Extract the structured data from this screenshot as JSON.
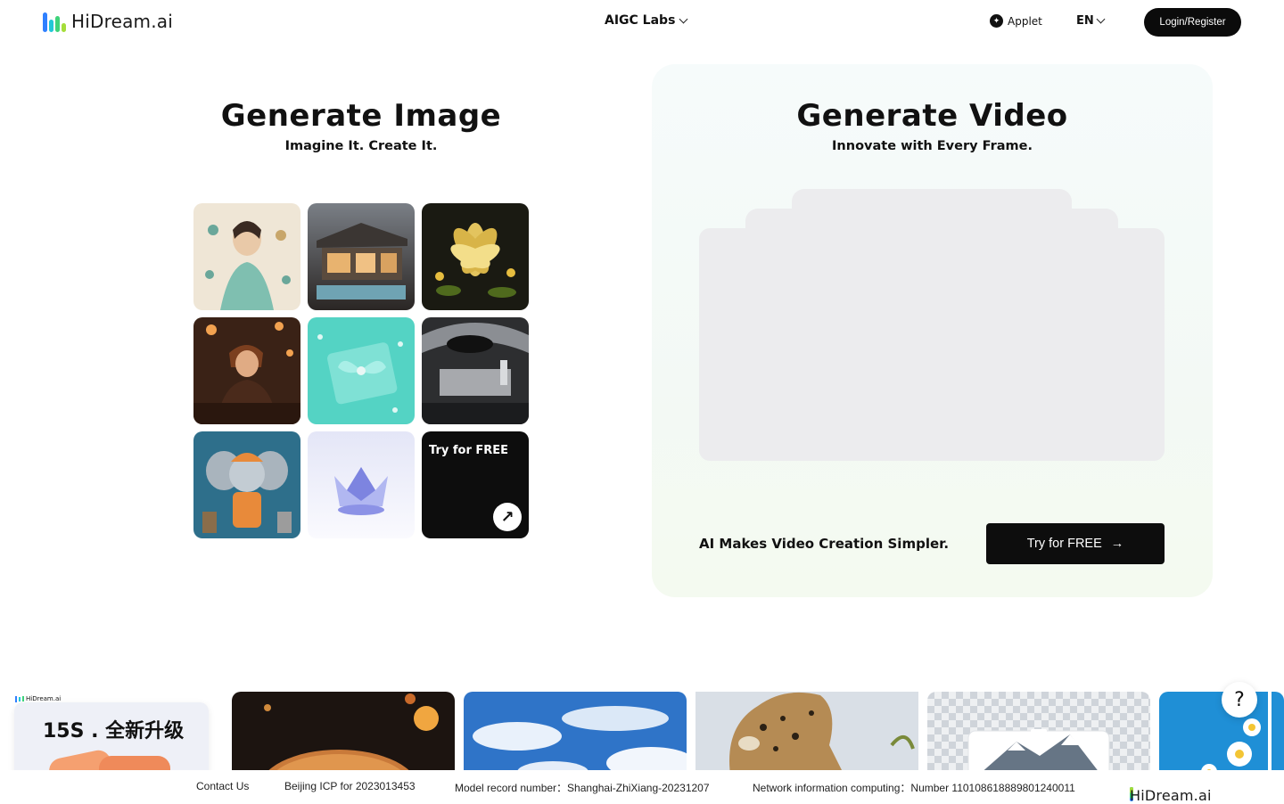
{
  "header": {
    "brand": "HiDream.ai",
    "nav_center": "AIGC Labs",
    "applet": "Applet",
    "language": "EN",
    "login": "Login/Register",
    "brand_colors": [
      "#2f80ff",
      "#22c7d6",
      "#3ed37a",
      "#a5dd3a"
    ]
  },
  "image_section": {
    "title": "Generate Image",
    "subtitle": "Imagine It. Create It.",
    "tiles": [
      {
        "name": "art-nouveau-woman-jewelry",
        "colors": [
          "#efe6d6",
          "#7fbfb0"
        ]
      },
      {
        "name": "modern-house-pool",
        "colors": [
          "#4b4a4a",
          "#c9a27a"
        ]
      },
      {
        "name": "golden-lotus",
        "colors": [
          "#1a1a12",
          "#e0c060"
        ]
      },
      {
        "name": "warrior-tavern",
        "colors": [
          "#3a2216",
          "#9b5a35"
        ]
      },
      {
        "name": "teal-gift-box",
        "colors": [
          "#54d3c4",
          "#8ee5db"
        ]
      },
      {
        "name": "spaceship-interior",
        "colors": [
          "#2d2e30",
          "#a7a9ad"
        ]
      },
      {
        "name": "cartoon-elephant-worker",
        "colors": [
          "#2e6f8b",
          "#e88a3a"
        ]
      },
      {
        "name": "crystal-crown",
        "colors": [
          "#eef0ff",
          "#7d84e0"
        ]
      }
    ],
    "try_label": "Try for FREE"
  },
  "video_section": {
    "title": "Generate Video",
    "subtitle": "Innovate with Every Frame.",
    "tagline": "AI Makes Video Creation Simpler.",
    "button": "Try for FREE"
  },
  "strip": {
    "promo_brand": "HiDream.ai",
    "promo_text": "15S . 全新升级",
    "cards": [
      {
        "name": "burger-splash",
        "colors": [
          "#1c1410",
          "#c97a3a"
        ]
      },
      {
        "name": "blue-sky-clouds",
        "colors": [
          "#2f74c8",
          "#e9f1fb"
        ]
      },
      {
        "name": "leopard-portrait",
        "colors": [
          "#d9dfe6",
          "#b58b54"
        ]
      },
      {
        "name": "mountain-transparent",
        "colors": [
          "#cfd4da",
          "#667585"
        ]
      },
      {
        "name": "daisies-blue",
        "colors": [
          "#1f8fd6",
          "#ffffff"
        ]
      }
    ],
    "help": "?"
  },
  "footer": {
    "contact": "Contact Us",
    "icp": "Beijing ICP for 2023013453",
    "model_record": "Model record number：Shanghai-ZhiXiang-20231207",
    "network": "Network information computing：Number 110108618889801240011",
    "brand": "HiDream.ai"
  }
}
